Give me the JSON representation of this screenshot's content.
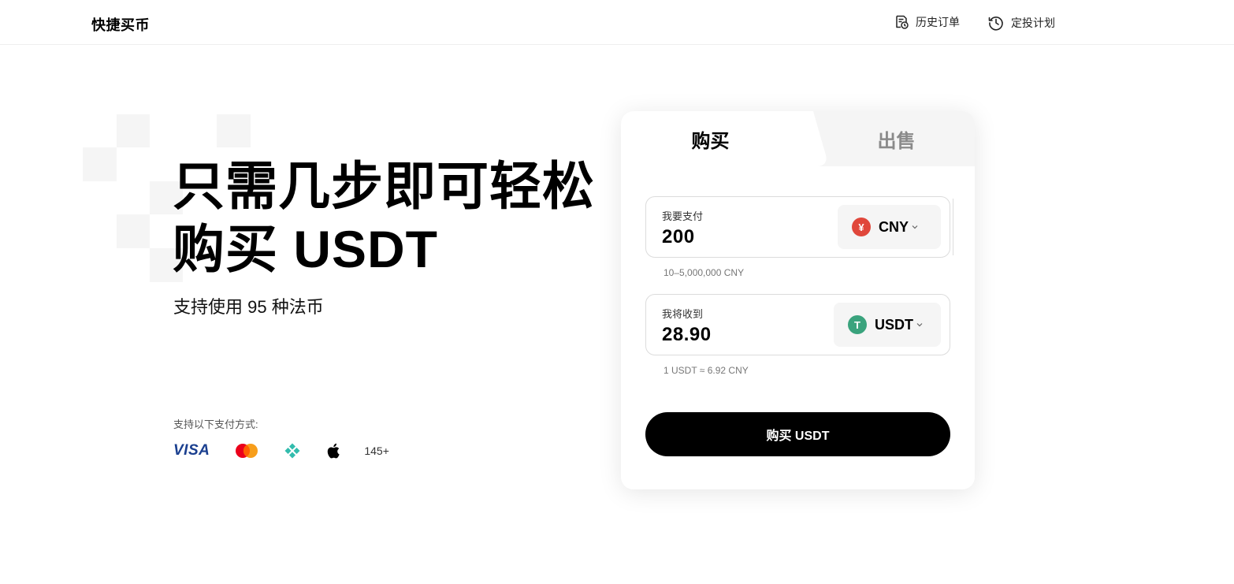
{
  "header": {
    "brand": "快捷买币",
    "history_label": "历史订单",
    "plan_label": "定投计划"
  },
  "hero": {
    "title_line1": "只需几步即可轻松",
    "title_line2": "购买 USDT",
    "subtitle": "支持使用 95 种法币",
    "payment_label": "支持以下支付方式:",
    "payment_methods": {
      "visa": "VISA",
      "more": "145+"
    }
  },
  "card": {
    "tabs": {
      "buy": "购买",
      "sell": "出售"
    },
    "pay": {
      "label": "我要支付",
      "value": "200",
      "currency": "CNY",
      "currency_icon": "¥",
      "limit_hint": "10–5,000,000 CNY"
    },
    "receive": {
      "label": "我将收到",
      "value": "28.90",
      "currency": "USDT",
      "currency_icon": "T",
      "rate_hint": "1 USDT ≈ 6.92 CNY"
    },
    "submit_label": "购买 USDT"
  },
  "colors": {
    "cny_badge": "#e0473b",
    "usdt_badge": "#3aa37d",
    "primary_button": "#000000"
  }
}
